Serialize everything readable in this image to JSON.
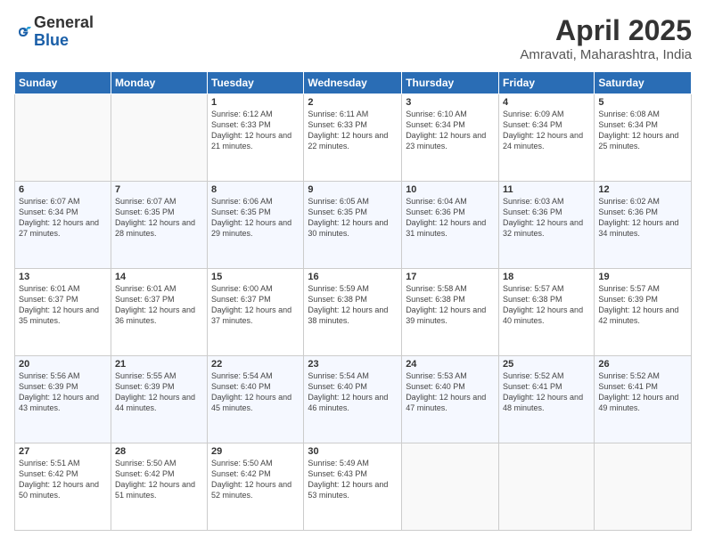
{
  "logo": {
    "general": "General",
    "blue": "Blue"
  },
  "title": {
    "month": "April 2025",
    "location": "Amravati, Maharashtra, India"
  },
  "days_header": [
    "Sunday",
    "Monday",
    "Tuesday",
    "Wednesday",
    "Thursday",
    "Friday",
    "Saturday"
  ],
  "weeks": [
    [
      {
        "day": "",
        "info": ""
      },
      {
        "day": "",
        "info": ""
      },
      {
        "day": "1",
        "info": "Sunrise: 6:12 AM\nSunset: 6:33 PM\nDaylight: 12 hours and 21 minutes."
      },
      {
        "day": "2",
        "info": "Sunrise: 6:11 AM\nSunset: 6:33 PM\nDaylight: 12 hours and 22 minutes."
      },
      {
        "day": "3",
        "info": "Sunrise: 6:10 AM\nSunset: 6:34 PM\nDaylight: 12 hours and 23 minutes."
      },
      {
        "day": "4",
        "info": "Sunrise: 6:09 AM\nSunset: 6:34 PM\nDaylight: 12 hours and 24 minutes."
      },
      {
        "day": "5",
        "info": "Sunrise: 6:08 AM\nSunset: 6:34 PM\nDaylight: 12 hours and 25 minutes."
      }
    ],
    [
      {
        "day": "6",
        "info": "Sunrise: 6:07 AM\nSunset: 6:34 PM\nDaylight: 12 hours and 27 minutes."
      },
      {
        "day": "7",
        "info": "Sunrise: 6:07 AM\nSunset: 6:35 PM\nDaylight: 12 hours and 28 minutes."
      },
      {
        "day": "8",
        "info": "Sunrise: 6:06 AM\nSunset: 6:35 PM\nDaylight: 12 hours and 29 minutes."
      },
      {
        "day": "9",
        "info": "Sunrise: 6:05 AM\nSunset: 6:35 PM\nDaylight: 12 hours and 30 minutes."
      },
      {
        "day": "10",
        "info": "Sunrise: 6:04 AM\nSunset: 6:36 PM\nDaylight: 12 hours and 31 minutes."
      },
      {
        "day": "11",
        "info": "Sunrise: 6:03 AM\nSunset: 6:36 PM\nDaylight: 12 hours and 32 minutes."
      },
      {
        "day": "12",
        "info": "Sunrise: 6:02 AM\nSunset: 6:36 PM\nDaylight: 12 hours and 34 minutes."
      }
    ],
    [
      {
        "day": "13",
        "info": "Sunrise: 6:01 AM\nSunset: 6:37 PM\nDaylight: 12 hours and 35 minutes."
      },
      {
        "day": "14",
        "info": "Sunrise: 6:01 AM\nSunset: 6:37 PM\nDaylight: 12 hours and 36 minutes."
      },
      {
        "day": "15",
        "info": "Sunrise: 6:00 AM\nSunset: 6:37 PM\nDaylight: 12 hours and 37 minutes."
      },
      {
        "day": "16",
        "info": "Sunrise: 5:59 AM\nSunset: 6:38 PM\nDaylight: 12 hours and 38 minutes."
      },
      {
        "day": "17",
        "info": "Sunrise: 5:58 AM\nSunset: 6:38 PM\nDaylight: 12 hours and 39 minutes."
      },
      {
        "day": "18",
        "info": "Sunrise: 5:57 AM\nSunset: 6:38 PM\nDaylight: 12 hours and 40 minutes."
      },
      {
        "day": "19",
        "info": "Sunrise: 5:57 AM\nSunset: 6:39 PM\nDaylight: 12 hours and 42 minutes."
      }
    ],
    [
      {
        "day": "20",
        "info": "Sunrise: 5:56 AM\nSunset: 6:39 PM\nDaylight: 12 hours and 43 minutes."
      },
      {
        "day": "21",
        "info": "Sunrise: 5:55 AM\nSunset: 6:39 PM\nDaylight: 12 hours and 44 minutes."
      },
      {
        "day": "22",
        "info": "Sunrise: 5:54 AM\nSunset: 6:40 PM\nDaylight: 12 hours and 45 minutes."
      },
      {
        "day": "23",
        "info": "Sunrise: 5:54 AM\nSunset: 6:40 PM\nDaylight: 12 hours and 46 minutes."
      },
      {
        "day": "24",
        "info": "Sunrise: 5:53 AM\nSunset: 6:40 PM\nDaylight: 12 hours and 47 minutes."
      },
      {
        "day": "25",
        "info": "Sunrise: 5:52 AM\nSunset: 6:41 PM\nDaylight: 12 hours and 48 minutes."
      },
      {
        "day": "26",
        "info": "Sunrise: 5:52 AM\nSunset: 6:41 PM\nDaylight: 12 hours and 49 minutes."
      }
    ],
    [
      {
        "day": "27",
        "info": "Sunrise: 5:51 AM\nSunset: 6:42 PM\nDaylight: 12 hours and 50 minutes."
      },
      {
        "day": "28",
        "info": "Sunrise: 5:50 AM\nSunset: 6:42 PM\nDaylight: 12 hours and 51 minutes."
      },
      {
        "day": "29",
        "info": "Sunrise: 5:50 AM\nSunset: 6:42 PM\nDaylight: 12 hours and 52 minutes."
      },
      {
        "day": "30",
        "info": "Sunrise: 5:49 AM\nSunset: 6:43 PM\nDaylight: 12 hours and 53 minutes."
      },
      {
        "day": "",
        "info": ""
      },
      {
        "day": "",
        "info": ""
      },
      {
        "day": "",
        "info": ""
      }
    ]
  ]
}
